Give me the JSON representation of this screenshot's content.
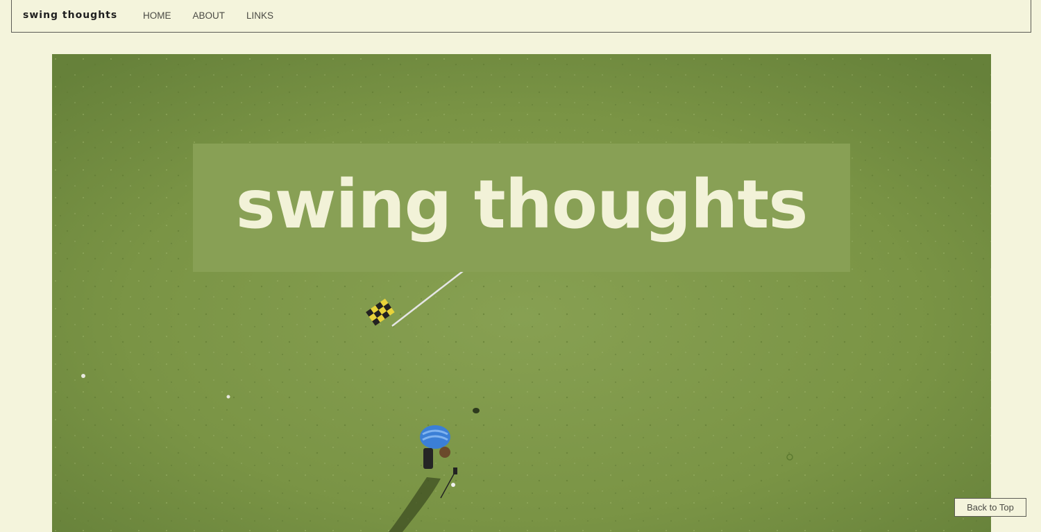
{
  "nav": {
    "site_title": "swing thoughts",
    "links": [
      {
        "label": "HOME"
      },
      {
        "label": "ABOUT"
      },
      {
        "label": "LINKS"
      }
    ]
  },
  "hero": {
    "title": "swing thoughts",
    "image_description": "aerial view of golfer putting on green with flag",
    "colors": {
      "grass": "#6f8d3a",
      "title_box": "#88a055",
      "title_text": "#f2f2d8"
    }
  },
  "back_to_top": {
    "label": "Back to Top"
  },
  "colors": {
    "page_background": "#f4f4dc",
    "border": "#5b5b54"
  }
}
